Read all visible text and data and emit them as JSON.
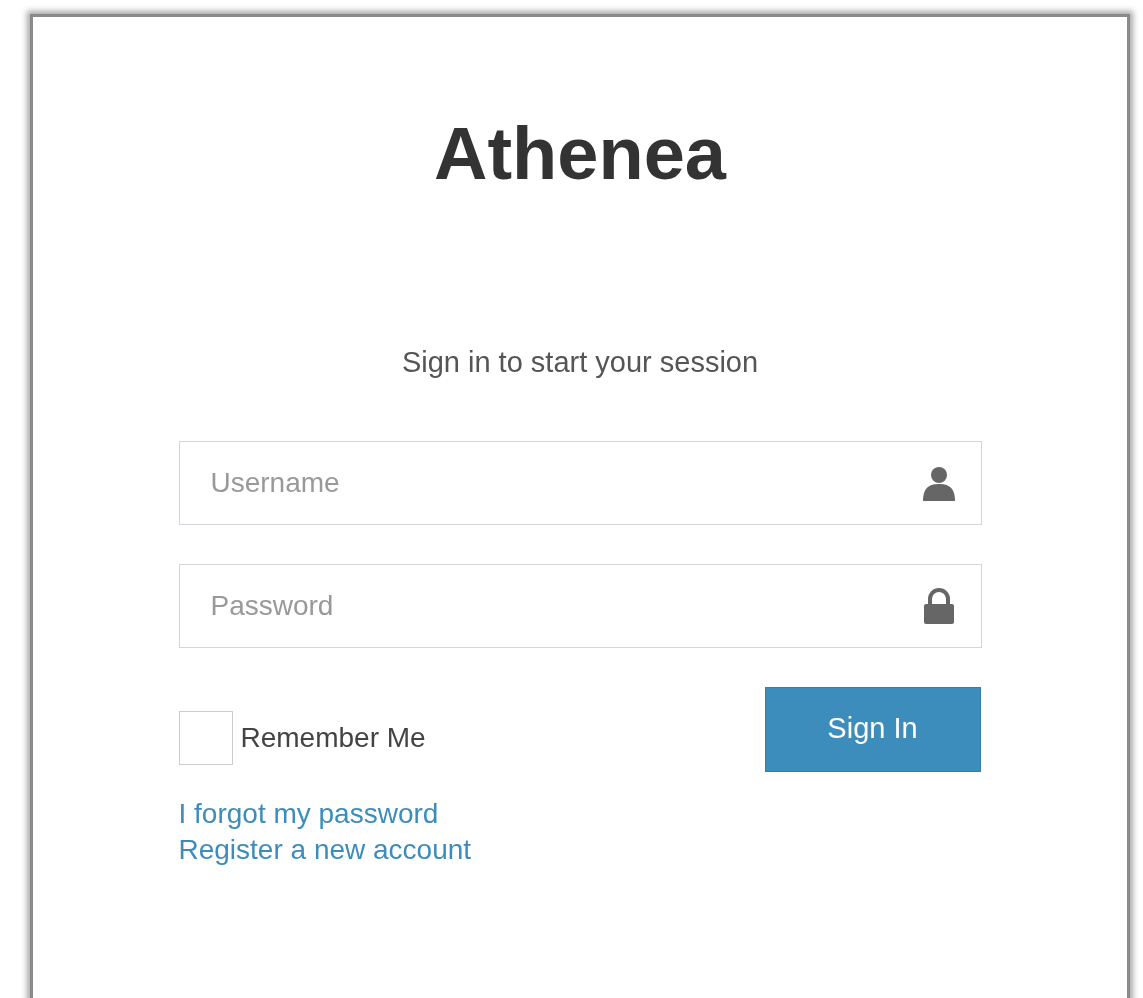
{
  "title": "Athenea",
  "subtitle": "Sign in to start your session",
  "fields": [
    {
      "kind": "username",
      "placeholder": "Username"
    },
    {
      "kind": "password",
      "placeholder": "Password"
    }
  ],
  "remember": {
    "label": "Remember Me",
    "checked": false
  },
  "button": "Sign In",
  "links": [
    "I forgot my password",
    "Register a new account"
  ]
}
